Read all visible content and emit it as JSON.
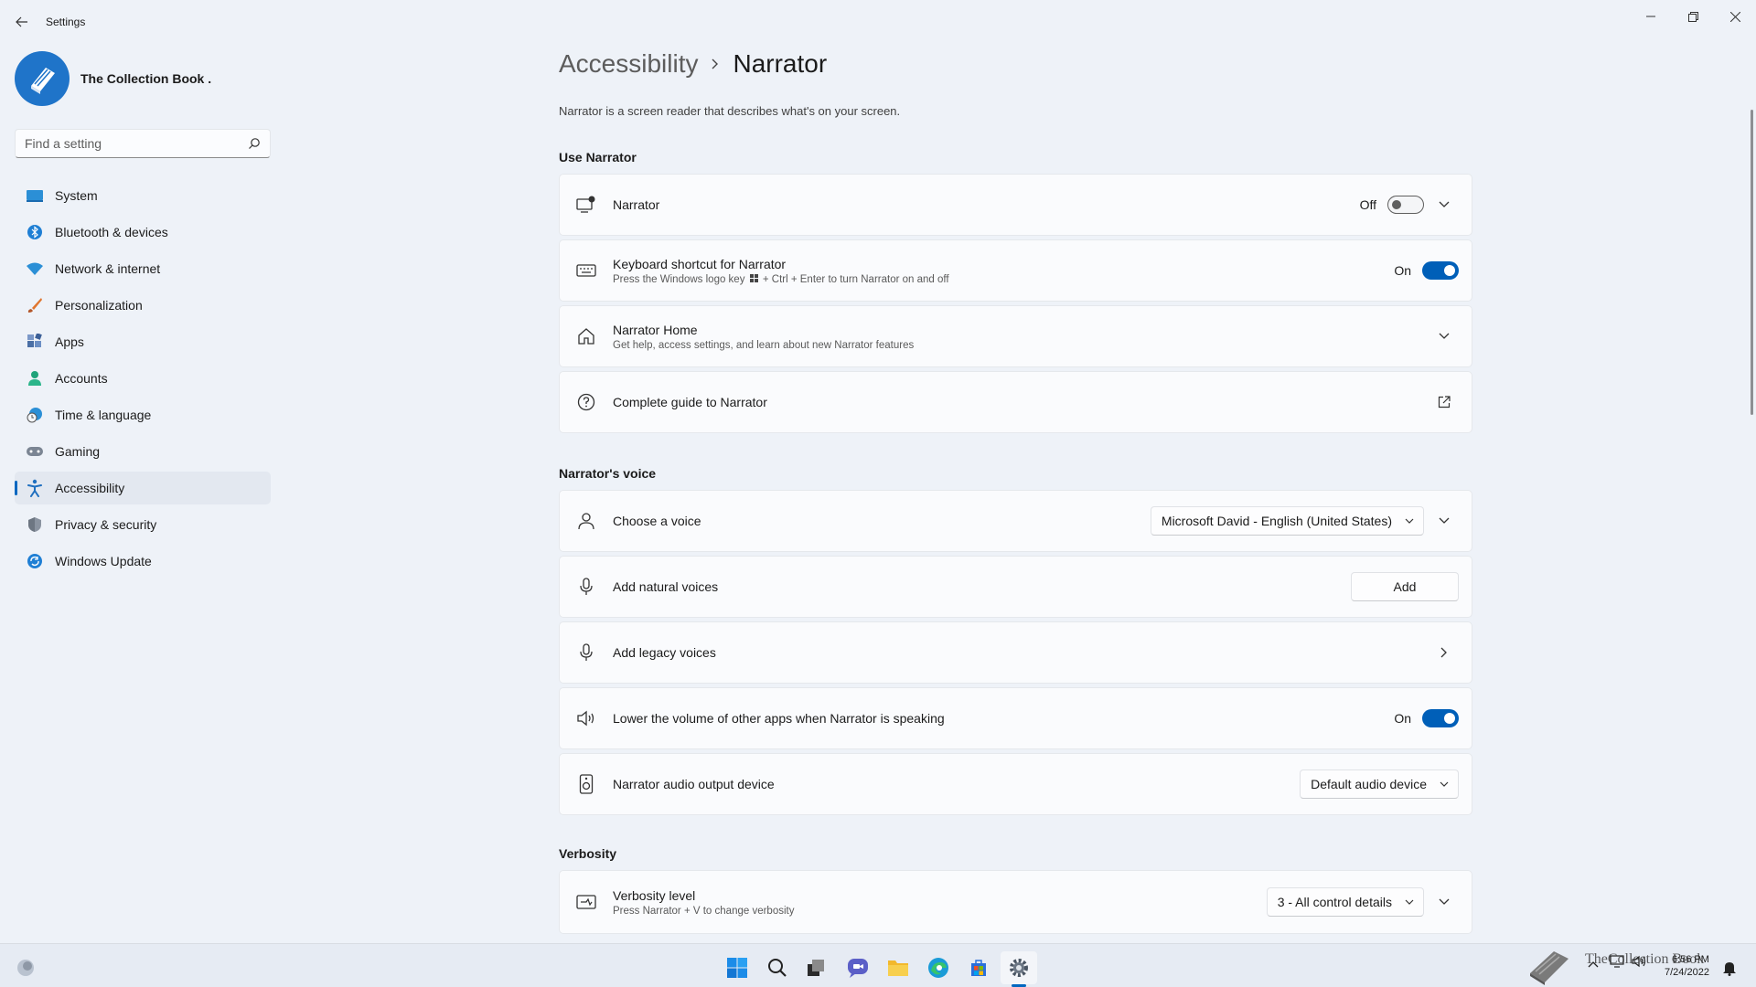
{
  "window": {
    "title": "Settings"
  },
  "profile": {
    "name": "The Collection Book ."
  },
  "search": {
    "placeholder": "Find a setting"
  },
  "sidebar": {
    "items": [
      {
        "label": "System"
      },
      {
        "label": "Bluetooth & devices"
      },
      {
        "label": "Network & internet"
      },
      {
        "label": "Personalization"
      },
      {
        "label": "Apps"
      },
      {
        "label": "Accounts"
      },
      {
        "label": "Time & language"
      },
      {
        "label": "Gaming"
      },
      {
        "label": "Accessibility"
      },
      {
        "label": "Privacy & security"
      },
      {
        "label": "Windows Update"
      }
    ],
    "active": "Accessibility"
  },
  "breadcrumb": {
    "parent": "Accessibility",
    "current": "Narrator"
  },
  "page": {
    "description": "Narrator is a screen reader that describes what's on your screen."
  },
  "sections": {
    "use_narrator": "Use Narrator",
    "voice": "Narrator's voice",
    "verbosity": "Verbosity"
  },
  "cards": {
    "narrator": {
      "title": "Narrator",
      "state": "Off"
    },
    "shortcut": {
      "title": "Keyboard shortcut for Narrator",
      "subtitle_a": "Press the Windows logo key",
      "subtitle_b": "+ Ctrl + Enter to turn Narrator on and off",
      "state": "On"
    },
    "home": {
      "title": "Narrator Home",
      "subtitle": "Get help, access settings, and learn about new Narrator features"
    },
    "guide": {
      "title": "Complete guide to Narrator"
    },
    "choose_voice": {
      "title": "Choose a voice",
      "value": "Microsoft David - English (United States)"
    },
    "natural": {
      "title": "Add natural voices",
      "button": "Add"
    },
    "legacy": {
      "title": "Add legacy voices"
    },
    "lower_volume": {
      "title": "Lower the volume of other apps when Narrator is speaking",
      "state": "On"
    },
    "audio_output": {
      "title": "Narrator audio output device",
      "value": "Default audio device"
    },
    "verbosity_level": {
      "title": "Verbosity level",
      "subtitle": "Press Narrator + V to change verbosity",
      "value": "3 - All control details"
    }
  },
  "taskbar": {
    "time": "6:56 PM",
    "date": "7/24/2022",
    "watermark": "TheCollection Book"
  },
  "colors": {
    "accent": "#005fb8",
    "background": "#eef2f8",
    "card": "#fafbfd"
  }
}
